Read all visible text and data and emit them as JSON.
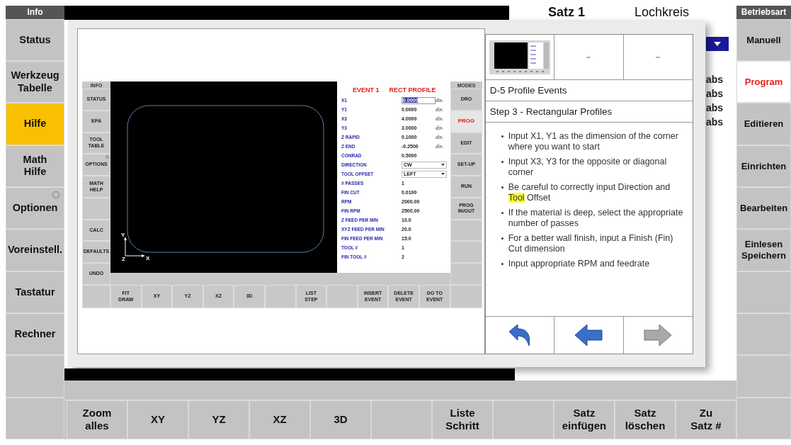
{
  "left_panel": {
    "header": "Info",
    "items": [
      {
        "kind": "button",
        "label": "Status",
        "selected": false
      },
      {
        "kind": "button",
        "label": "Werkzeug\nTabelle",
        "selected": false
      },
      {
        "kind": "button",
        "label": "Hilfe",
        "selected": true
      },
      {
        "kind": "button",
        "label": "Math\nHilfe",
        "selected": false
      },
      {
        "kind": "button",
        "label": "Optionen",
        "selected": false,
        "indicator_on": false
      },
      {
        "kind": "button",
        "label": "Voreinstell.",
        "selected": false
      },
      {
        "kind": "button",
        "label": "Tastatur",
        "selected": false
      },
      {
        "kind": "button",
        "label": "Rechner",
        "selected": false
      },
      {
        "kind": "blank",
        "selected": false
      },
      {
        "kind": "blank",
        "selected": false
      }
    ]
  },
  "background": {
    "block_title": "Satz 1",
    "block_type": "Lochkreis",
    "units": [
      "abs",
      "abs",
      "abs",
      "abs"
    ]
  },
  "help_window": {
    "inner_screen": {
      "info_header": "INFO",
      "info_items": [
        {
          "kind": "button",
          "label": "STATUS",
          "selected": false
        },
        {
          "kind": "button",
          "label": "EPA",
          "selected": false
        },
        {
          "kind": "button",
          "label": "TOOL\nTABLE",
          "selected": false
        },
        {
          "kind": "button",
          "label": "OPTIONS",
          "selected": false,
          "indicator_on": false
        },
        {
          "kind": "button",
          "label": "MATH\nHELP",
          "selected": false
        },
        {
          "kind": "blank",
          "selected": false
        },
        {
          "kind": "button",
          "label": "CALC",
          "selected": false
        },
        {
          "kind": "button",
          "label": "DEFAULTS",
          "selected": false
        },
        {
          "kind": "button",
          "label": "UNDO",
          "selected": false
        }
      ],
      "canvas": {
        "axes": {
          "x": "X",
          "y": "Y",
          "z": "Z"
        }
      },
      "event": {
        "number": "EVENT 1",
        "type": "RECT PROFILE"
      },
      "fields": [
        {
          "kind": "input",
          "label": "X1",
          "value": "0.0000",
          "unit": "abs",
          "text_selected": true
        },
        {
          "kind": "text",
          "label": "Y1",
          "value": "0.0000",
          "unit": "abs"
        },
        {
          "kind": "text",
          "label": "X3",
          "value": "4.0000",
          "unit": "abs"
        },
        {
          "kind": "text",
          "label": "Y3",
          "value": "3.0000",
          "unit": "abs"
        },
        {
          "kind": "text",
          "label": "Z RAPID",
          "value": "0.1000",
          "unit": "abs"
        },
        {
          "kind": "text",
          "label": "Z END",
          "value": "-0.2500",
          "unit": "abs"
        },
        {
          "kind": "text",
          "label": "CONRAD",
          "value": "0.5000"
        },
        {
          "kind": "dropdown",
          "label": "DIRECTION",
          "value": "CW"
        },
        {
          "kind": "dropdown",
          "label": "TOOL OFFSET",
          "value": "LEFT"
        },
        {
          "kind": "text",
          "label": "# PASSES",
          "value": "1"
        },
        {
          "kind": "text",
          "label": "FIN CUT",
          "value": "0.0100"
        },
        {
          "kind": "text",
          "label": "RPM",
          "value": "2000.00"
        },
        {
          "kind": "text",
          "label": "FIN RPM",
          "value": "2500.00"
        },
        {
          "kind": "text",
          "label": "Z FEED PER MIN",
          "value": "10.0"
        },
        {
          "kind": "text",
          "label": "XYZ FEED PER MIN",
          "value": "20.0"
        },
        {
          "kind": "text",
          "label": "FIN FEED PER MIN",
          "value": "15.0"
        },
        {
          "kind": "text",
          "label": "TOOL #",
          "value": "1"
        },
        {
          "kind": "text",
          "label": "FIN TOOL #",
          "value": "2"
        }
      ],
      "modes_header": "MODES",
      "modes": [
        {
          "kind": "button",
          "label": "DRO",
          "selected": false
        },
        {
          "kind": "button",
          "label": "PROG",
          "selected": true
        },
        {
          "kind": "button",
          "label": "EDIT",
          "selected": false
        },
        {
          "kind": "button",
          "label": "SET-UP",
          "selected": false
        },
        {
          "kind": "button",
          "label": "RUN",
          "selected": false
        },
        {
          "kind": "button",
          "label": "PROG\nIN/OUT",
          "selected": false
        },
        {
          "kind": "blank",
          "selected": false
        },
        {
          "kind": "blank",
          "selected": false
        },
        {
          "kind": "blank",
          "selected": false
        }
      ],
      "bottom_buttons": [
        {
          "kind": "blank"
        },
        {
          "kind": "button",
          "label": "FIT\nDRAW"
        },
        {
          "kind": "button",
          "label": "XY"
        },
        {
          "kind": "button",
          "label": "YZ"
        },
        {
          "kind": "button",
          "label": "XZ"
        },
        {
          "kind": "button",
          "label": "3D"
        },
        {
          "kind": "blank"
        },
        {
          "kind": "button",
          "label": "LIST\nSTEP"
        },
        {
          "kind": "blank"
        },
        {
          "kind": "button",
          "label": "INSERT\nEVENT"
        },
        {
          "kind": "button",
          "label": "DELETE\nEVENT"
        },
        {
          "kind": "button",
          "label": "GO TO\nEVENT"
        },
        {
          "kind": "blank"
        }
      ]
    },
    "help": {
      "section": "D-5 Profile Events",
      "step": "Step 3 - Rectangular Profiles",
      "bullets": [
        {
          "parts": [
            {
              "text": "Input X1, Y1 as the dimension of the corner where you want to start",
              "highlighted": false
            }
          ]
        },
        {
          "parts": [
            {
              "text": "Input X3, Y3 for the opposite or diagonal corner",
              "highlighted": false
            }
          ]
        },
        {
          "parts": [
            {
              "text": "Be careful to correctly input Direction and ",
              "highlighted": false
            },
            {
              "text": "Tool",
              "highlighted": true
            },
            {
              "text": " Offset",
              "highlighted": false
            }
          ]
        },
        {
          "parts": [
            {
              "text": "If the material is deep, select the appropriate number of passes",
              "highlighted": false
            }
          ]
        },
        {
          "parts": [
            {
              "text": "For a better wall finish, input a Finish (Fin) Cut dimension",
              "highlighted": false
            }
          ]
        },
        {
          "parts": [
            {
              "text": "Input appropriate RPM and feedrate",
              "highlighted": false
            }
          ]
        }
      ],
      "nav": [
        {
          "kind": "back",
          "disabled": false
        },
        {
          "kind": "previous",
          "disabled": false
        },
        {
          "kind": "next",
          "disabled": true
        }
      ]
    }
  },
  "right_panel": {
    "header": "Betriebsart",
    "items": [
      {
        "kind": "button",
        "label": "Manuell",
        "selected": false
      },
      {
        "kind": "button",
        "label": "Program",
        "selected": true
      },
      {
        "kind": "button",
        "label": "Editieren",
        "selected": false
      },
      {
        "kind": "button",
        "label": "Einrichten",
        "selected": false
      },
      {
        "kind": "button",
        "label": "Bearbeiten",
        "selected": false
      },
      {
        "kind": "button",
        "label": "Einlesen\nSpeichern",
        "selected": false
      },
      {
        "kind": "blank",
        "selected": false
      },
      {
        "kind": "blank",
        "selected": false
      },
      {
        "kind": "blank",
        "selected": false
      },
      {
        "kind": "blank",
        "selected": false
      }
    ]
  },
  "bottom_bar": {
    "buttons": [
      {
        "kind": "button",
        "label": "Zoom\nalles"
      },
      {
        "kind": "button",
        "label": "XY"
      },
      {
        "kind": "button",
        "label": "YZ"
      },
      {
        "kind": "button",
        "label": "XZ"
      },
      {
        "kind": "button",
        "label": "3D"
      },
      {
        "kind": "blank"
      },
      {
        "kind": "button",
        "label": "Liste\nSchritt"
      },
      {
        "kind": "blank"
      },
      {
        "kind": "button",
        "label": "Satz\neinfügen"
      },
      {
        "kind": "button",
        "label": "Satz\nlöschen"
      },
      {
        "kind": "button",
        "label": "Zu\nSatz #"
      }
    ]
  }
}
